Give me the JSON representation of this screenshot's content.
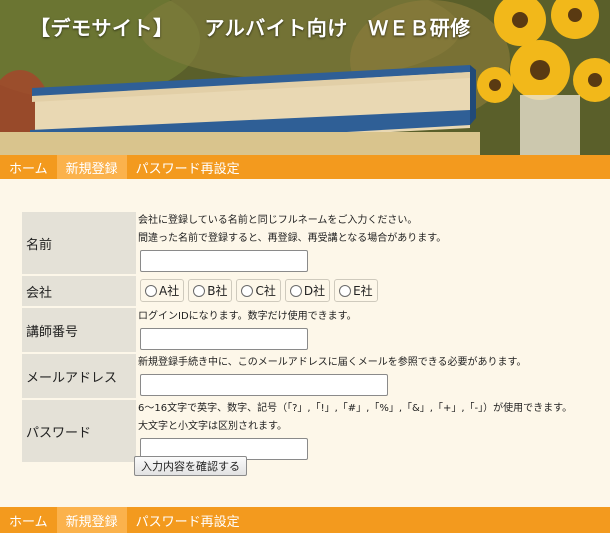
{
  "header": {
    "title": "【デモサイト】　　アルバイト向け　ＷＥＢ研修"
  },
  "nav": {
    "items": [
      {
        "label": "ホーム",
        "active": false
      },
      {
        "label": "新規登録",
        "active": true
      },
      {
        "label": "パスワード再設定",
        "active": false
      }
    ]
  },
  "form": {
    "name": {
      "label": "名前",
      "hint1": "会社に登録している名前と同じフルネームをご入力ください。",
      "hint2": "間違った名前で登録すると、再登録、再受講となる場合があります。",
      "value": ""
    },
    "company": {
      "label": "会社",
      "options": [
        "A社",
        "B社",
        "C社",
        "D社",
        "E社"
      ]
    },
    "instructor_id": {
      "label": "講師番号",
      "hint": "ログインIDになります。数字だけ使用できます。",
      "value": ""
    },
    "email": {
      "label": "メールアドレス",
      "hint": "新規登録手続き中に、このメールアドレスに届くメールを参照できる必要があります。",
      "value": ""
    },
    "password": {
      "label": "パスワード",
      "hint1": "6～16文字で英字、数字、記号（「?」,「!」,「#」,「%」,「&」,「+」,「-」）が使用できます。",
      "hint2": "大文字と小文字は区別されます。",
      "value": ""
    },
    "confirm_label": "入力内容を確認する"
  },
  "colors": {
    "nav_bg": "#f39a1e",
    "nav_active": "#fbb24c",
    "page_bg": "#fdf7e9",
    "label_bg": "#e4e1d7"
  }
}
